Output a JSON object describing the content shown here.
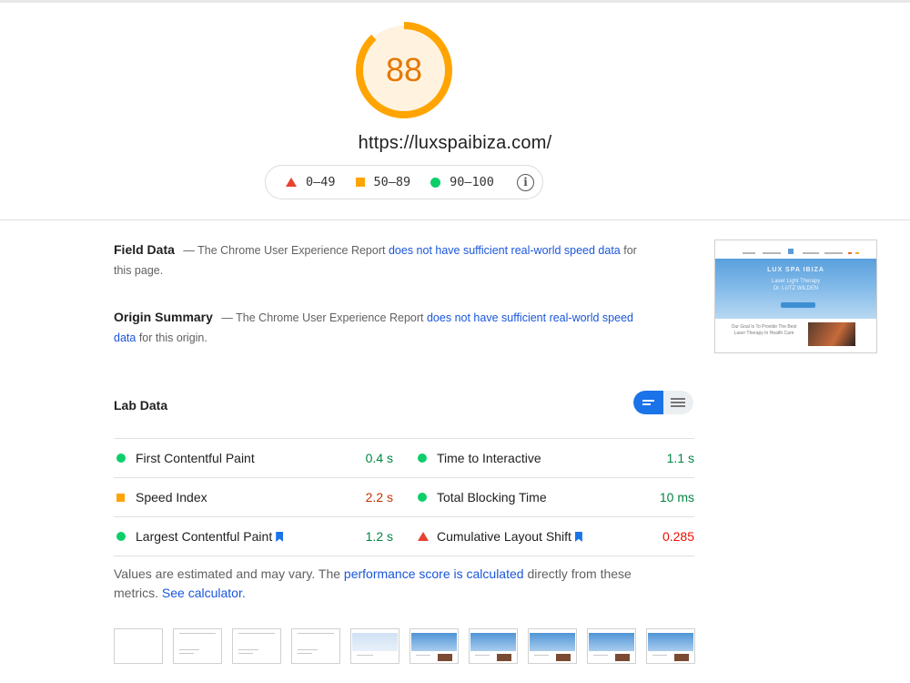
{
  "score": {
    "value": "88",
    "color": "#ffa400",
    "fraction": 0.88
  },
  "url": "https://luxspaibiza.com/",
  "legend": [
    {
      "shape": "triangle",
      "label": "0–49",
      "color": "#e8412f"
    },
    {
      "shape": "square",
      "label": "50–89",
      "color": "#ffa400"
    },
    {
      "shape": "circle",
      "label": "90–100",
      "color": "#0cce6b"
    }
  ],
  "legend_info_icon": "info-icon",
  "field_data": {
    "title": "Field Data",
    "prefix": "— The Chrome User Experience Report",
    "link": "does not have sufficient real-world speed data",
    "suffix": "for this page."
  },
  "origin_summary": {
    "title": "Origin Summary",
    "prefix": "— The Chrome User Experience Report",
    "link": "does not have sufficient real-world speed data",
    "suffix": "for this origin."
  },
  "screenshot": {
    "hero_title": "LUX SPA IBIZA",
    "hero_line1": "Laser Light Therapy",
    "hero_line2": "Dr. LUTZ WILDEN",
    "body_text": "Our Goal Is To Provide The Best Laser Therapy In Health Care"
  },
  "lab_data": {
    "title": "Lab Data",
    "metrics": [
      {
        "name": "First Contentful Paint",
        "value": "0.4 s",
        "rating": "pass",
        "bookmark": false
      },
      {
        "name": "Time to Interactive",
        "value": "1.1 s",
        "rating": "pass",
        "bookmark": false
      },
      {
        "name": "Speed Index",
        "value": "2.2 s",
        "rating": "average",
        "bookmark": false
      },
      {
        "name": "Total Blocking Time",
        "value": "10 ms",
        "rating": "pass",
        "bookmark": false
      },
      {
        "name": "Largest Contentful Paint",
        "value": "1.2 s",
        "rating": "pass",
        "bookmark": true
      },
      {
        "name": "Cumulative Layout Shift",
        "value": "0.285",
        "rating": "fail",
        "bookmark": true
      }
    ]
  },
  "note": {
    "text1": "Values are estimated and may vary. The",
    "link1": "performance score is calculated",
    "text2": "directly from these metrics.",
    "link2": "See calculator."
  },
  "filmstrip_frames": [
    "blank",
    "sparse",
    "sparse",
    "sparse",
    "pale",
    "full",
    "full",
    "full",
    "full",
    "full"
  ],
  "colors": {
    "pass": "#018642",
    "average": "#c33300",
    "fail": "#eb0f00",
    "accent": "#1a73e8"
  }
}
